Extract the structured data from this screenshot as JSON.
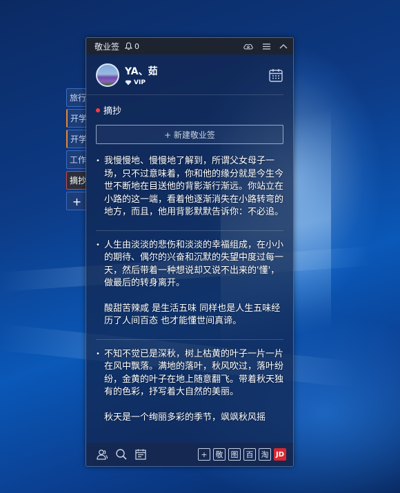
{
  "app": {
    "title": "敬业签",
    "notification_count": "0"
  },
  "user": {
    "name": "YA、茹",
    "badge": "VIP"
  },
  "side_tabs": [
    {
      "label": "旅行"
    },
    {
      "label": "开学"
    },
    {
      "label": "开学"
    },
    {
      "label": "工作"
    },
    {
      "label": "摘抄"
    },
    {
      "label": "+"
    }
  ],
  "section": {
    "title": "摘抄"
  },
  "new_button": {
    "label": "+ 新建敬业签"
  },
  "notes": [
    {
      "paragraphs": [
        "我慢慢地、慢慢地了解到，所谓父女母子一场，只不过意味着，你和他的缘分就是今生今世不断地在目送他的背影渐行渐远。你站立在小路的这一端，看着他逐渐消失在小路转弯的地方，而且，他用背影默默告诉你：不必追。"
      ]
    },
    {
      "paragraphs": [
        "人生由淡淡的悲伤和淡淡的幸福组成，在小小的期待、偶尔的兴奋和沉默的失望中度过每一天，然后带着一种想说却又说不出来的'懂'，做最后的转身离开。",
        "酸甜苦辣咸 是生活五味 同样也是人生五味经历了人间百态 也才能懂世间真谛。"
      ]
    },
    {
      "paragraphs": [
        "不知不觉已是深秋，树上枯黄的叶子一片一片在风中飘落。满地的落叶，秋风吹过，落叶纷纷，金黄的叶子在地上随意翻飞。带着秋天独有的色彩，抒写着大自然的美丽。",
        "秋天是一个绚丽多彩的季节，飒飒秋风摇"
      ]
    }
  ],
  "footer": {
    "left_icons": [
      "contacts-icon",
      "search-icon",
      "calendar-note-icon"
    ],
    "right_buttons": [
      "+",
      "敬",
      "图",
      "百",
      "淘",
      "JD"
    ]
  },
  "colors": {
    "accent_red": "#ff3b3b",
    "jd_red": "#d9282f",
    "window_bg": "#12264e"
  }
}
